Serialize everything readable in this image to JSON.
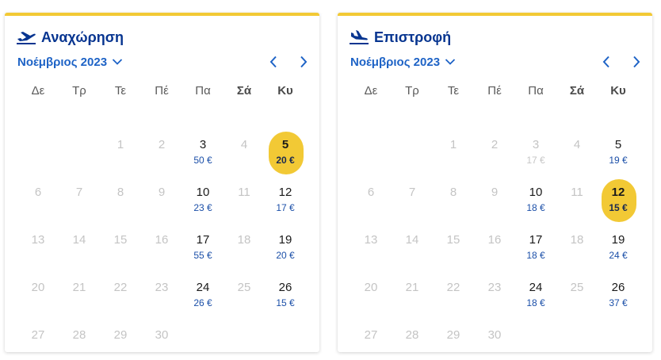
{
  "colors": {
    "accent": "#f2c935",
    "brand": "#073590",
    "link": "#1e63c6",
    "price": "#1b4fa8"
  },
  "departure": {
    "title": "Αναχώρηση",
    "icon": "plane-takeoff-icon",
    "month": "Νοέμβριος 2023",
    "weekdays": [
      "Δε",
      "Τρ",
      "Τε",
      "Πέ",
      "Πα",
      "Σά",
      "Κυ"
    ],
    "days": [
      {
        "day": "1"
      },
      {
        "day": "2"
      },
      {
        "day": "3",
        "price": "50 €",
        "available": true
      },
      {
        "day": "4"
      },
      {
        "day": "5",
        "price": "20 €",
        "available": true,
        "selected": true
      },
      {
        "day": "6"
      },
      {
        "day": "7"
      },
      {
        "day": "8"
      },
      {
        "day": "9"
      },
      {
        "day": "10",
        "price": "23 €",
        "available": true
      },
      {
        "day": "11"
      },
      {
        "day": "12",
        "price": "17 €",
        "available": true
      },
      {
        "day": "13"
      },
      {
        "day": "14"
      },
      {
        "day": "15"
      },
      {
        "day": "16"
      },
      {
        "day": "17",
        "price": "55 €",
        "available": true
      },
      {
        "day": "18"
      },
      {
        "day": "19",
        "price": "20 €",
        "available": true
      },
      {
        "day": "20"
      },
      {
        "day": "21"
      },
      {
        "day": "22"
      },
      {
        "day": "23"
      },
      {
        "day": "24",
        "price": "26 €",
        "available": true
      },
      {
        "day": "25"
      },
      {
        "day": "26",
        "price": "15 €",
        "available": true
      },
      {
        "day": "27"
      },
      {
        "day": "28"
      },
      {
        "day": "29"
      },
      {
        "day": "30"
      }
    ]
  },
  "return": {
    "title": "Επιστροφή",
    "icon": "plane-landing-icon",
    "month": "Νοέμβριος 2023",
    "weekdays": [
      "Δε",
      "Τρ",
      "Τε",
      "Πέ",
      "Πα",
      "Σά",
      "Κυ"
    ],
    "days": [
      {
        "day": "1"
      },
      {
        "day": "2"
      },
      {
        "day": "3",
        "price": "17 €",
        "dim": true
      },
      {
        "day": "4"
      },
      {
        "day": "5",
        "price": "19 €",
        "available": true
      },
      {
        "day": "6"
      },
      {
        "day": "7"
      },
      {
        "day": "8"
      },
      {
        "day": "9"
      },
      {
        "day": "10",
        "price": "18 €",
        "available": true
      },
      {
        "day": "11"
      },
      {
        "day": "12",
        "price": "15 €",
        "available": true,
        "selected": true
      },
      {
        "day": "13"
      },
      {
        "day": "14"
      },
      {
        "day": "15"
      },
      {
        "day": "16"
      },
      {
        "day": "17",
        "price": "18 €",
        "available": true
      },
      {
        "day": "18"
      },
      {
        "day": "19",
        "price": "24 €",
        "available": true
      },
      {
        "day": "20"
      },
      {
        "day": "21"
      },
      {
        "day": "22"
      },
      {
        "day": "23"
      },
      {
        "day": "24",
        "price": "18 €",
        "available": true
      },
      {
        "day": "25"
      },
      {
        "day": "26",
        "price": "37 €",
        "available": true
      },
      {
        "day": "27"
      },
      {
        "day": "28"
      },
      {
        "day": "29"
      },
      {
        "day": "30"
      }
    ]
  }
}
